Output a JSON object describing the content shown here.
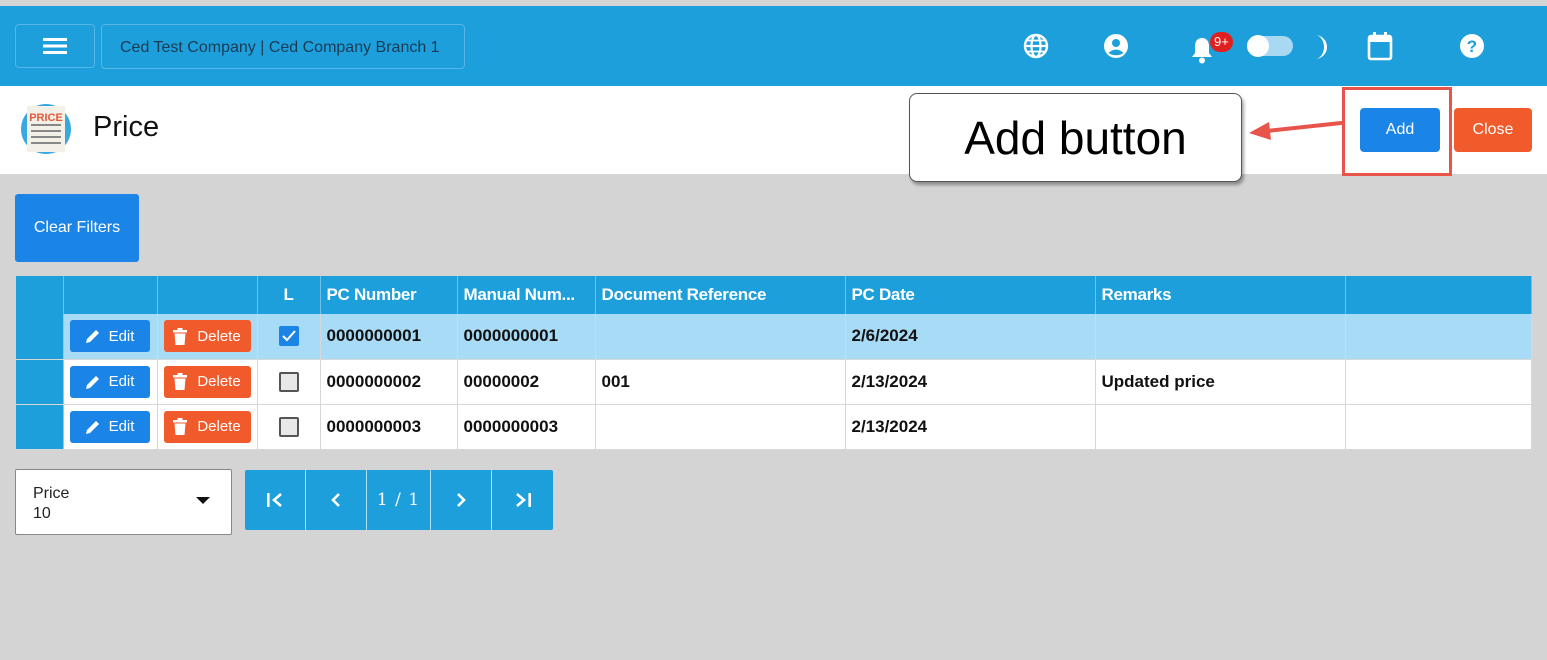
{
  "topbar": {
    "company": "Ced Test Company | Ced Company Branch 1",
    "notification_badge": "9+",
    "icons": [
      "menu-icon",
      "globe-icon",
      "user-icon",
      "bell-icon",
      "moon-icon",
      "calendar-icon",
      "help-icon"
    ]
  },
  "header": {
    "title": "Price",
    "logo_text": "PRICE",
    "add_label": "Add",
    "close_label": "Close"
  },
  "annotation": {
    "callout_text": "Add button"
  },
  "filters": {
    "clear_label": "Clear Filters"
  },
  "grid": {
    "columns": [
      "",
      "",
      "",
      "L",
      "PC Number",
      "Manual Num...",
      "Document Reference",
      "PC Date",
      "Remarks",
      ""
    ],
    "edit_label": "Edit",
    "delete_label": "Delete",
    "rows": [
      {
        "checked": true,
        "pc_number": "0000000001",
        "manual_number": "0000000001",
        "document_reference": "",
        "pc_date": "2/6/2024",
        "remarks": ""
      },
      {
        "checked": false,
        "pc_number": "0000000002",
        "manual_number": "00000002",
        "document_reference": "001",
        "pc_date": "2/13/2024",
        "remarks": "Updated price"
      },
      {
        "checked": false,
        "pc_number": "0000000003",
        "manual_number": "0000000003",
        "document_reference": "",
        "pc_date": "2/13/2024",
        "remarks": ""
      }
    ]
  },
  "pagination": {
    "page_size_label": "Price",
    "page_size_value": "10",
    "page_info": "1 / 1"
  },
  "colors": {
    "primary": "#1c9fdb",
    "button_blue": "#1a85e7",
    "danger": "#f15a2b",
    "selected_row": "#a8dbf5",
    "highlight": "#e8534a"
  }
}
